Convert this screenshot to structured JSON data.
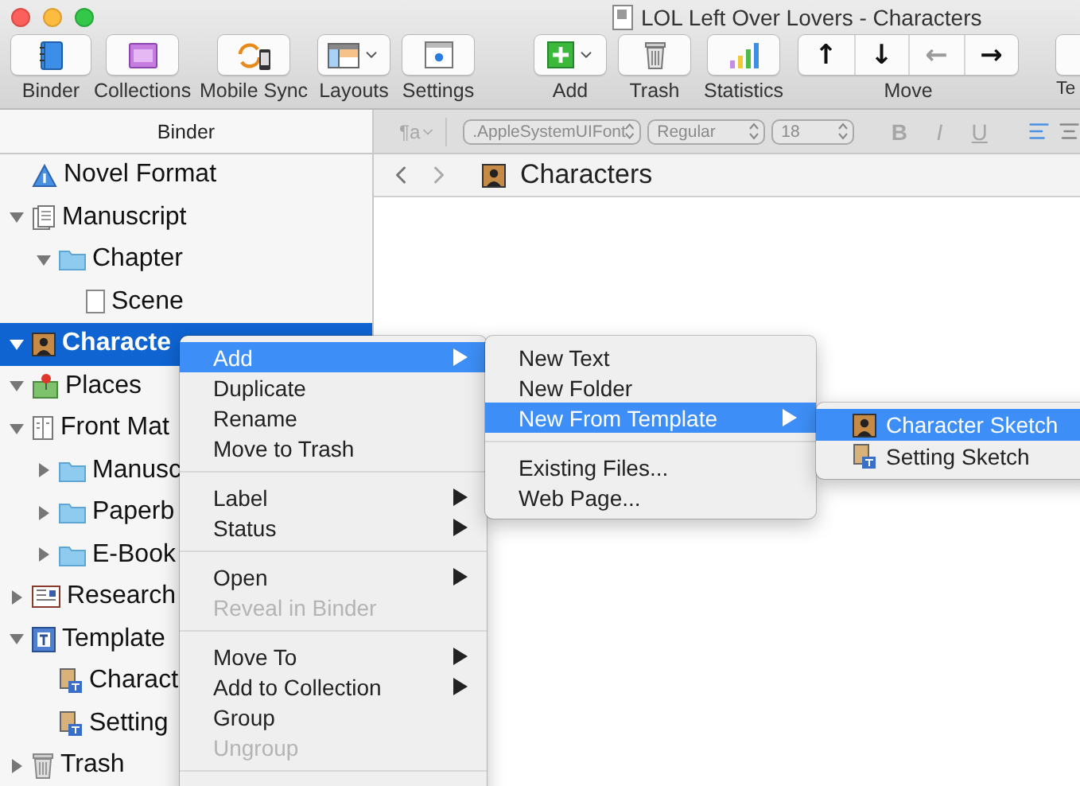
{
  "window": {
    "title": "LOL Left Over Lovers - Characters"
  },
  "toolbar": [
    {
      "label": "Binder",
      "has_menu": false
    },
    {
      "label": "Collections",
      "has_menu": false
    },
    {
      "label": "Mobile Sync",
      "has_menu": false
    },
    {
      "label": "Layouts",
      "has_menu": true
    },
    {
      "label": "Settings",
      "has_menu": false
    },
    {
      "label": "Add",
      "has_menu": true
    },
    {
      "label": "Trash",
      "has_menu": false
    },
    {
      "label": "Statistics",
      "has_menu": false
    },
    {
      "label": "Move",
      "arrows": [
        {
          "glyph": "↑",
          "disabled": false
        },
        {
          "glyph": "↓",
          "disabled": false
        },
        {
          "glyph": "←",
          "disabled": true
        },
        {
          "glyph": "→",
          "disabled": false
        }
      ]
    },
    {
      "label": "Te"
    }
  ],
  "format_bar": {
    "paragraph": "¶a",
    "font": ".AppleSystemUIFont",
    "style": "Regular",
    "size": "18",
    "buttons": [
      "B",
      "I",
      "U"
    ]
  },
  "binder": {
    "header": "Binder",
    "items": [
      {
        "label": "Novel Format",
        "kind": "info",
        "selected": false
      },
      {
        "label": "Manuscript",
        "kind": "manuscript",
        "selected": false,
        "expanded": true,
        "children": [
          {
            "label": "Chapter",
            "kind": "folder",
            "selected": false,
            "expanded": true,
            "children": [
              {
                "label": "Scene",
                "kind": "document",
                "selected": false
              }
            ]
          }
        ]
      },
      {
        "label": "Characte",
        "kind": "characters",
        "selected": true,
        "expanded": true
      },
      {
        "label": "Places",
        "kind": "places",
        "selected": false,
        "expanded": true
      },
      {
        "label": "Front Mat",
        "kind": "frontmatter",
        "selected": false,
        "expanded": true,
        "children": [
          {
            "label": "Manusc",
            "kind": "folder",
            "selected": false,
            "expanded": false
          },
          {
            "label": "Paperb",
            "kind": "folder",
            "selected": false,
            "expanded": false
          },
          {
            "label": "E-Book",
            "kind": "folder",
            "selected": false,
            "expanded": false
          }
        ]
      },
      {
        "label": "Research",
        "kind": "research",
        "selected": false,
        "expanded": false
      },
      {
        "label": "Template",
        "kind": "templates",
        "selected": false,
        "expanded": true,
        "children": [
          {
            "label": "Charact",
            "kind": "sketch",
            "selected": false
          },
          {
            "label": "Setting",
            "kind": "sketch",
            "selected": false
          }
        ]
      },
      {
        "label": "Trash",
        "kind": "trash",
        "selected": false,
        "expanded": false
      }
    ]
  },
  "editor": {
    "title": "Characters"
  },
  "context_menu": {
    "continues": true,
    "groups": [
      [
        {
          "label": "Add",
          "selected": true,
          "disabled": false,
          "submenu": true
        },
        {
          "label": "Duplicate",
          "selected": false,
          "disabled": false,
          "submenu": false
        },
        {
          "label": "Rename",
          "selected": false,
          "disabled": false,
          "submenu": false
        },
        {
          "label": "Move to Trash",
          "selected": false,
          "disabled": false,
          "submenu": false
        }
      ],
      [
        {
          "label": "Label",
          "selected": false,
          "disabled": false,
          "submenu": true
        },
        {
          "label": "Status",
          "selected": false,
          "disabled": false,
          "submenu": true
        }
      ],
      [
        {
          "label": "Open",
          "selected": false,
          "disabled": false,
          "submenu": true
        },
        {
          "label": "Reveal in Binder",
          "selected": false,
          "disabled": true,
          "submenu": false
        }
      ],
      [
        {
          "label": "Move To",
          "selected": false,
          "disabled": false,
          "submenu": true
        },
        {
          "label": "Add to Collection",
          "selected": false,
          "disabled": false,
          "submenu": true
        },
        {
          "label": "Group",
          "selected": false,
          "disabled": false,
          "submenu": false
        },
        {
          "label": "Ungroup",
          "selected": false,
          "disabled": true,
          "submenu": false
        }
      ]
    ]
  },
  "add_menu": {
    "groups": [
      [
        {
          "label": "New Text",
          "selected": false,
          "disabled": false,
          "submenu": false
        },
        {
          "label": "New Folder",
          "selected": false,
          "disabled": false,
          "submenu": false
        },
        {
          "label": "New From Template",
          "selected": true,
          "disabled": false,
          "submenu": true
        }
      ],
      [
        {
          "label": "Existing Files...",
          "selected": false,
          "disabled": false,
          "submenu": false
        },
        {
          "label": "Web Page...",
          "selected": false,
          "disabled": false,
          "submenu": false
        }
      ]
    ]
  },
  "template_menu": {
    "items": [
      {
        "label": "Character Sketch",
        "selected": true
      },
      {
        "label": "Setting Sketch",
        "selected": false
      }
    ]
  }
}
